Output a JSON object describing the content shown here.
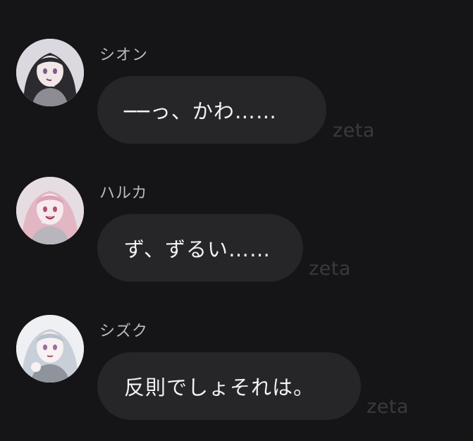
{
  "messages": [
    {
      "sender": "シオン",
      "avatar_icon": "character-avatar-dark-hair",
      "text": "──っ、かわ……",
      "watermark": "zeta"
    },
    {
      "sender": "ハルカ",
      "avatar_icon": "character-avatar-pink-hair",
      "text": "ず、ずるい……",
      "watermark": "zeta"
    },
    {
      "sender": "シズク",
      "avatar_icon": "character-avatar-silver-hair",
      "text": "反則でしょそれは。",
      "watermark": "zeta"
    }
  ],
  "colors": {
    "background": "#151416",
    "bubble": "#262528",
    "text": "#f3f2f5",
    "name": "#bdbac0",
    "watermark": "#3a393d"
  }
}
